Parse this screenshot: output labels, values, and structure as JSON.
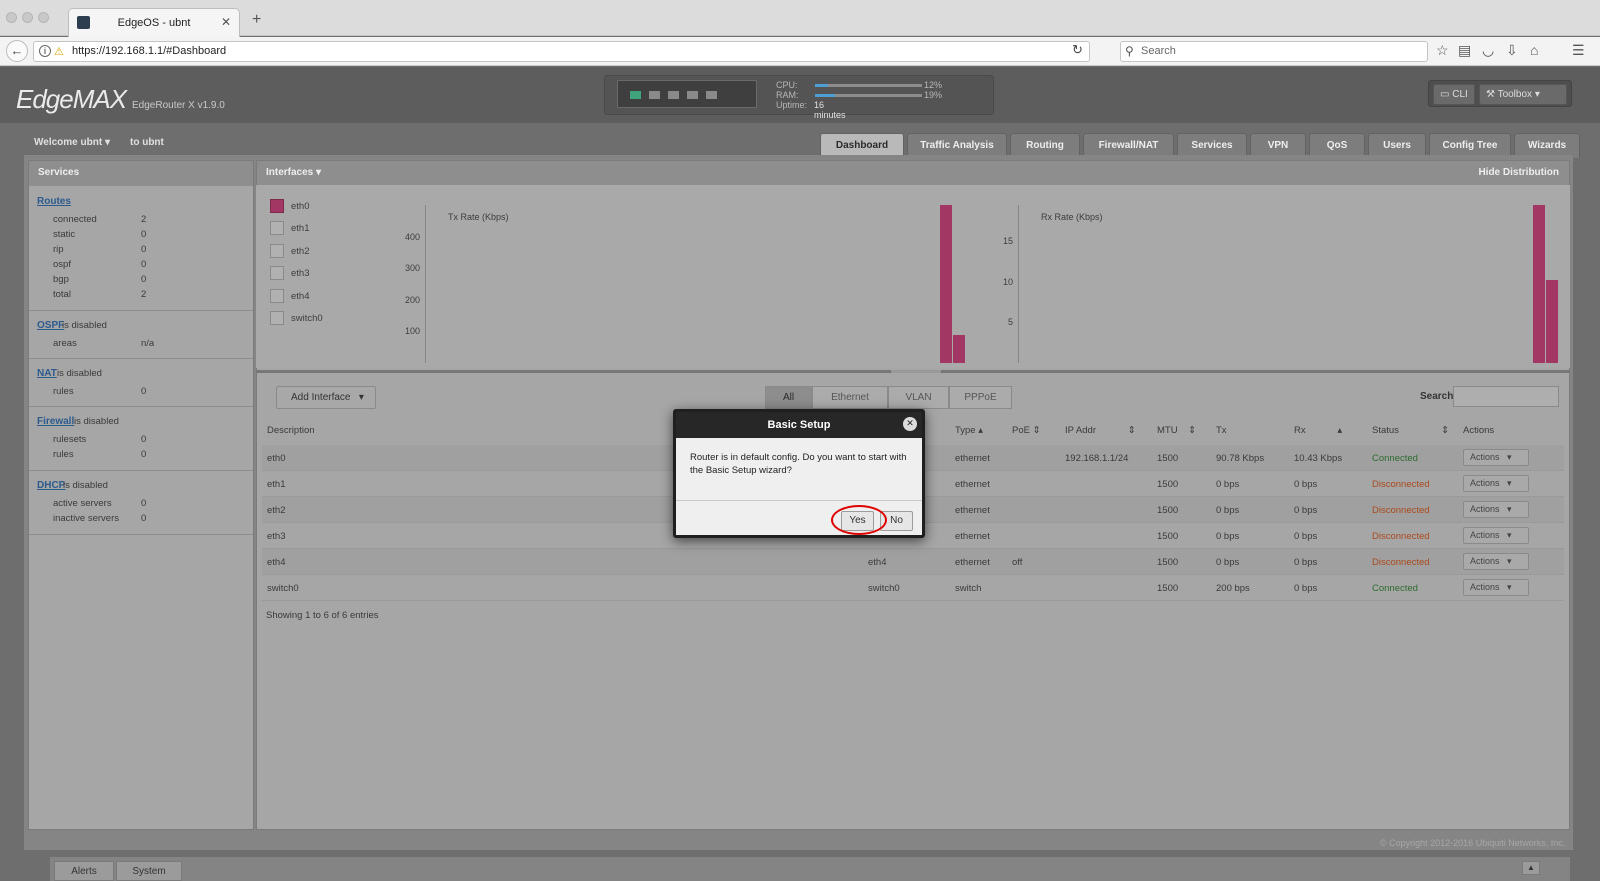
{
  "browser": {
    "tab_title": "EdgeOS - ubnt",
    "url": "https://192.168.1.1/#Dashboard",
    "search_placeholder": "Search"
  },
  "header": {
    "logo": "EdgeMAX",
    "model": "EdgeRouter X v1.9.0",
    "cpu_label": "CPU:",
    "cpu_value": "12%",
    "cpu_fraction": 0.12,
    "ram_label": "RAM:",
    "ram_value": "19%",
    "ram_fraction": 0.19,
    "uptime_label": "Uptime:",
    "uptime_value": "16 minutes",
    "cli_label": "CLI",
    "toolbox_label": "Toolbox"
  },
  "welcome": {
    "user": "Welcome ubnt",
    "to": "to ubnt"
  },
  "nav_tabs": [
    "Dashboard",
    "Traffic Analysis",
    "Routing",
    "Firewall/NAT",
    "Services",
    "VPN",
    "QoS",
    "Users",
    "Config Tree",
    "Wizards"
  ],
  "services": {
    "title": "Services",
    "routes": {
      "link": "Routes",
      "items": [
        {
          "label": "connected",
          "value": "2"
        },
        {
          "label": "static",
          "value": "0"
        },
        {
          "label": "rip",
          "value": "0"
        },
        {
          "label": "ospf",
          "value": "0"
        },
        {
          "label": "bgp",
          "value": "0"
        },
        {
          "label": "total",
          "value": "2"
        }
      ]
    },
    "ospf": {
      "link": "OSPF",
      "status": "is disabled",
      "items": [
        {
          "label": "areas",
          "value": "n/a"
        }
      ]
    },
    "nat": {
      "link": "NAT",
      "status": "is disabled",
      "items": [
        {
          "label": "rules",
          "value": "0"
        }
      ]
    },
    "firewall": {
      "link": "Firewall",
      "status": "is disabled",
      "items": [
        {
          "label": "rulesets",
          "value": "0"
        },
        {
          "label": "rules",
          "value": "0"
        }
      ]
    },
    "dhcp": {
      "link": "DHCP",
      "status": "is disabled",
      "items": [
        {
          "label": "active servers",
          "value": "0"
        },
        {
          "label": "inactive servers",
          "value": "0"
        }
      ]
    }
  },
  "interfaces_panel": {
    "title": "Interfaces",
    "hide_label": "Hide Distribution",
    "legend": [
      "eth0",
      "eth1",
      "eth2",
      "eth3",
      "eth4",
      "switch0"
    ],
    "legend_selected": "eth0"
  },
  "chart_data": [
    {
      "type": "bar",
      "title": "Tx Rate (Kbps)",
      "y_ticks": [
        "100",
        "200",
        "300",
        "400"
      ],
      "ylim": [
        0,
        500
      ],
      "series": [
        {
          "name": "eth0",
          "values": [
            500,
            90
          ]
        }
      ],
      "color": "#a33763"
    },
    {
      "type": "bar",
      "title": "Rx Rate (Kbps)",
      "y_ticks": [
        "5",
        "10",
        "15"
      ],
      "ylim": [
        0,
        19.5
      ],
      "series": [
        {
          "name": "eth0",
          "values": [
            19.5,
            10.2
          ]
        }
      ],
      "color": "#a33763"
    }
  ],
  "table_toolbar": {
    "add_interface": "Add Interface",
    "filters": [
      "All",
      "Ethernet",
      "VLAN",
      "PPPoE"
    ],
    "filter_active": "All",
    "search_label": "Search"
  },
  "table": {
    "headers": [
      "Description",
      "Type",
      "PoE",
      "IP Addr",
      "MTU",
      "Tx",
      "Rx",
      "Status",
      "Actions"
    ],
    "rows": [
      {
        "description": "eth0",
        "name": "",
        "type": "ethernet",
        "poe": "",
        "ip": "192.168.1.1/24",
        "mtu": "1500",
        "tx": "90.78 Kbps",
        "rx": "10.43 Kbps",
        "status": "Connected",
        "action": "Actions"
      },
      {
        "description": "eth1",
        "name": "",
        "type": "ethernet",
        "poe": "",
        "ip": "",
        "mtu": "1500",
        "tx": "0 bps",
        "rx": "0 bps",
        "status": "Disconnected",
        "action": "Actions"
      },
      {
        "description": "eth2",
        "name": "",
        "type": "ethernet",
        "poe": "",
        "ip": "",
        "mtu": "1500",
        "tx": "0 bps",
        "rx": "0 bps",
        "status": "Disconnected",
        "action": "Actions"
      },
      {
        "description": "eth3",
        "name": "",
        "type": "ethernet",
        "poe": "",
        "ip": "",
        "mtu": "1500",
        "tx": "0 bps",
        "rx": "0 bps",
        "status": "Disconnected",
        "action": "Actions"
      },
      {
        "description": "eth4",
        "name": "eth4",
        "type": "ethernet",
        "poe": "off",
        "ip": "",
        "mtu": "1500",
        "tx": "0 bps",
        "rx": "0 bps",
        "status": "Disconnected",
        "action": "Actions"
      },
      {
        "description": "switch0",
        "name": "switch0",
        "type": "switch",
        "poe": "",
        "ip": "",
        "mtu": "1500",
        "tx": "200 bps",
        "rx": "0 bps",
        "status": "Connected",
        "action": "Actions"
      }
    ],
    "showing": "Showing 1 to 6 of 6 entries"
  },
  "copyright": "© Copyright 2012-2016 Ubiquiti Networks, Inc.",
  "footer": {
    "alerts": "Alerts",
    "system": "System"
  },
  "dialog": {
    "title": "Basic Setup",
    "message": "Router is in default config. Do you want to start with the Basic Setup wizard?",
    "yes": "Yes",
    "no": "No"
  }
}
